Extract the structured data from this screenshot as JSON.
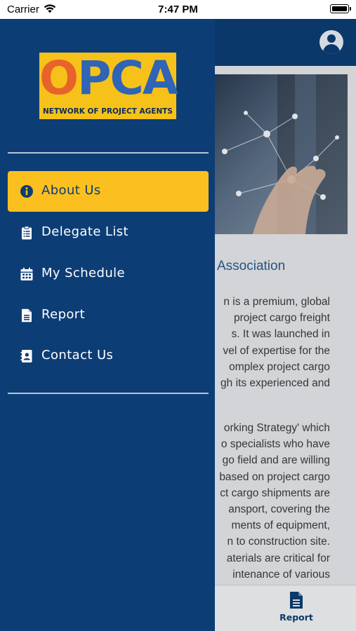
{
  "status_bar": {
    "carrier": "Carrier",
    "time": "7:47 PM"
  },
  "drawer": {
    "logo": {
      "word_first": "O",
      "word_rest": "PCA",
      "subtitle": "NETWORK OF PROJECT AGENTS"
    },
    "menu": [
      {
        "label": "About Us",
        "icon": "info-circle-icon",
        "active": true
      },
      {
        "label": "Delegate List",
        "icon": "clipboard-list-icon",
        "active": false
      },
      {
        "label": "My Schedule",
        "icon": "calendar-icon",
        "active": false
      },
      {
        "label": "Report",
        "icon": "document-icon",
        "active": false
      },
      {
        "label": "Contact Us",
        "icon": "contact-book-icon",
        "active": false
      }
    ]
  },
  "background": {
    "heading": "Association",
    "paragraph1": [
      "n is a premium, global",
      "project cargo freight",
      "s. It was launched in",
      "vel of expertise for the",
      "omplex project cargo",
      "gh its experienced and"
    ],
    "paragraph2": [
      "orking Strategy' which",
      "o specialists who have",
      "go field and are willing",
      "based on project cargo",
      "ct cargo shipments are",
      "ansport, covering the",
      "ments of equipment,",
      "n to construction site.",
      "aterials are critical for",
      "intenance of various"
    ],
    "tab_report_label": "Report"
  },
  "colors": {
    "primary": "#0d3d75",
    "accent": "#fbc020",
    "logo_orange": "#e8632a",
    "logo_blue": "#2f64b6"
  }
}
